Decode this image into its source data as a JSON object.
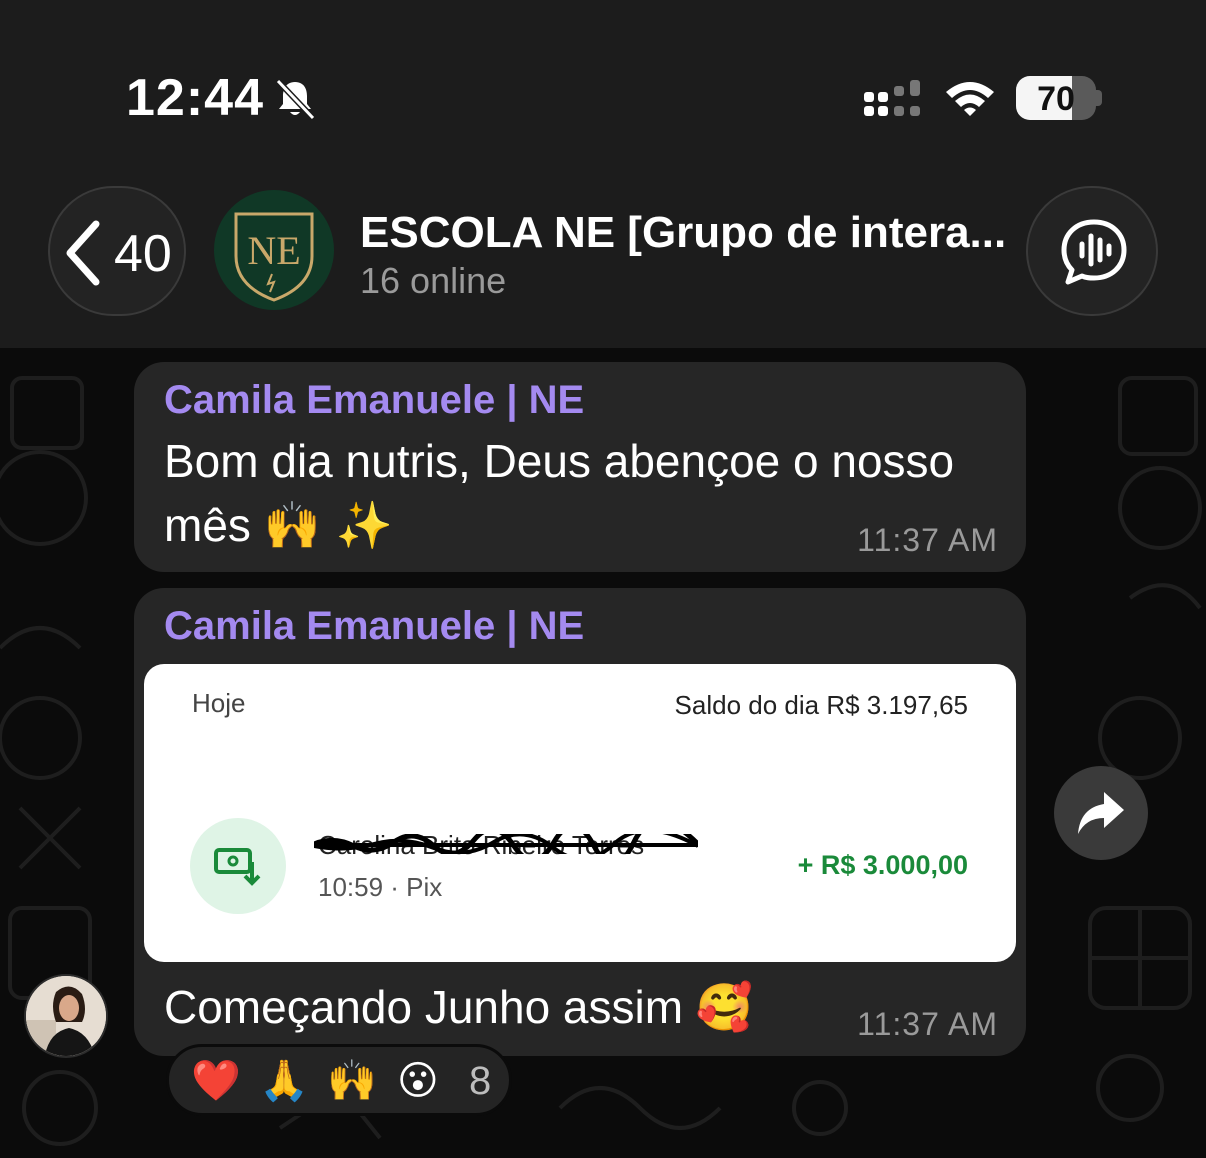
{
  "status_bar": {
    "time": "12:44",
    "battery": "70",
    "battery_level": 0.7,
    "icons": [
      "bell-slash-icon",
      "signal-icon",
      "wifi-icon",
      "battery-icon"
    ]
  },
  "header": {
    "back_count": "40",
    "group_name": "ESCOLA NE [Grupo de intera...",
    "group_status": "16 online",
    "avatar_initials": "NE",
    "icons": [
      "chevron-left-icon",
      "voice-chat-icon"
    ]
  },
  "messages": [
    {
      "sender": "Camila Emanuele | NE",
      "line1": "Bom dia nutris, Deus abençoe o nosso",
      "line2": "mês",
      "line2_emoji": "🙌 ✨",
      "time": "11:37 AM"
    },
    {
      "sender": "Camila Emanuele | NE",
      "image": {
        "today": "Hoje",
        "balance": "Saldo do dia R$ 3.197,65",
        "name": "Carolina Brito Ribeiro Torres",
        "sub": "10:59 · Pix",
        "amount": "+ R$ 3.000,00"
      },
      "caption": "Começando Junho assim",
      "caption_emoji": "🥰",
      "time": "11:37 AM"
    }
  ],
  "reactions": {
    "items": [
      "❤️",
      "🙏",
      "🙌",
      "😮"
    ],
    "count": "8"
  },
  "colors": {
    "sender": "#a48af0",
    "bubble": "#262626",
    "pix_amount": "#1a8a3a"
  }
}
